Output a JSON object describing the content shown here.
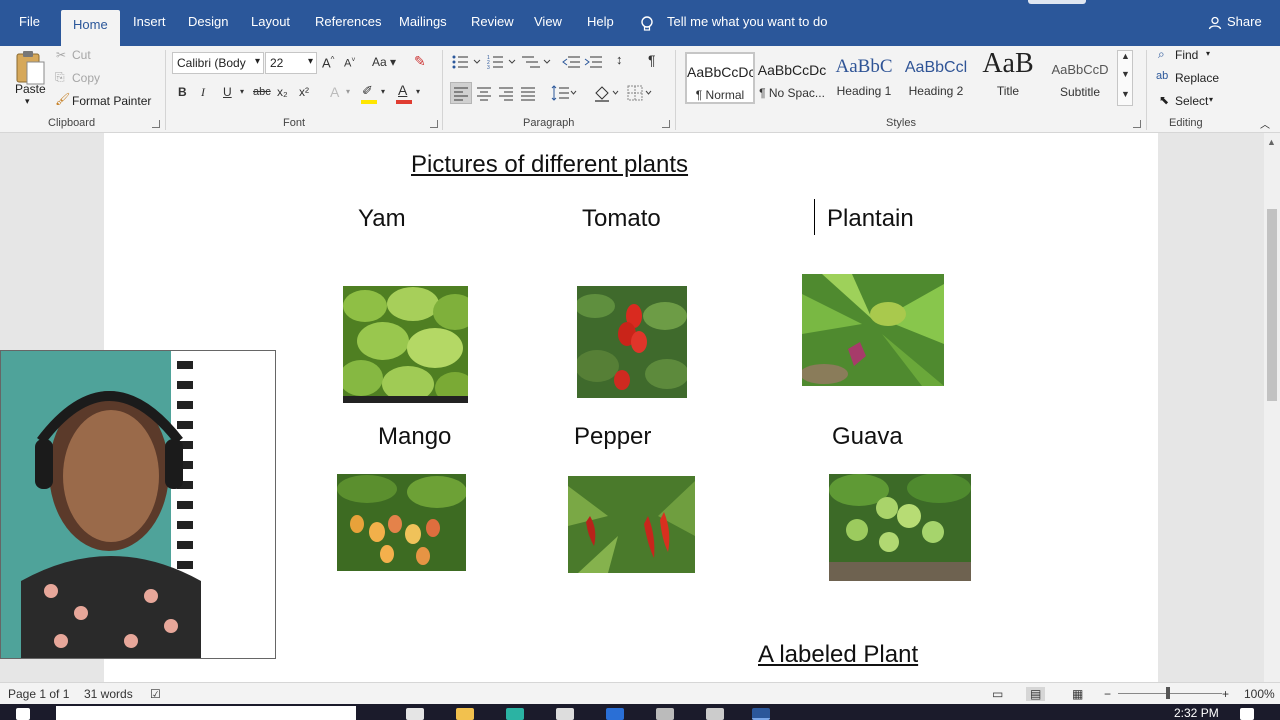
{
  "tabs": {
    "file": "File",
    "home": "Home",
    "insert": "Insert",
    "design": "Design",
    "layout": "Layout",
    "references": "References",
    "mailings": "Mailings",
    "review": "Review",
    "view": "View",
    "help": "Help",
    "tell_me": "Tell me what you want to do",
    "share": "Share"
  },
  "clipboard": {
    "paste": "Paste",
    "cut": "Cut",
    "copy": "Copy",
    "format_painter": "Format Painter",
    "label": "Clipboard"
  },
  "font": {
    "name": "Calibri (Body",
    "size": "22",
    "grow": "A^",
    "shrink": "A˅",
    "change_case": "Aa",
    "bold": "B",
    "italic": "I",
    "underline": "U",
    "strike": "abc",
    "subscript": "x₂",
    "superscript": "x²",
    "color_letter": "A",
    "label": "Font"
  },
  "paragraph": {
    "label": "Paragraph",
    "pilcrow": "¶"
  },
  "styles": {
    "label": "Styles",
    "items": [
      {
        "preview": "AaBbCcDc",
        "name": "¶ Normal"
      },
      {
        "preview": "AaBbCcDc",
        "name": "¶ No Spac..."
      },
      {
        "preview": "AaBbC",
        "name": "Heading 1"
      },
      {
        "preview": "AaBbCcl",
        "name": "Heading 2"
      },
      {
        "preview": "AaB",
        "name": "Title"
      },
      {
        "preview": "AaBbCcD",
        "name": "Subtitle"
      }
    ]
  },
  "editing": {
    "label": "Editing",
    "find": "Find",
    "replace": "Replace",
    "select": "Select"
  },
  "document": {
    "title": "Pictures of different plants",
    "row1": [
      "Yam",
      "Tomato",
      "Plantain"
    ],
    "row2": [
      "Mango",
      "Pepper",
      "Guava"
    ],
    "bottom_heading": "A labeled Plant"
  },
  "status": {
    "page": "Page 1 of 1",
    "words": "31 words",
    "zoom": "100%"
  },
  "taskbar": {
    "clock": "2:32 PM"
  },
  "colors": {
    "accent": "#2b579a",
    "font_color_bar": "#e03c31",
    "highlight_bar": "#ffe600"
  }
}
